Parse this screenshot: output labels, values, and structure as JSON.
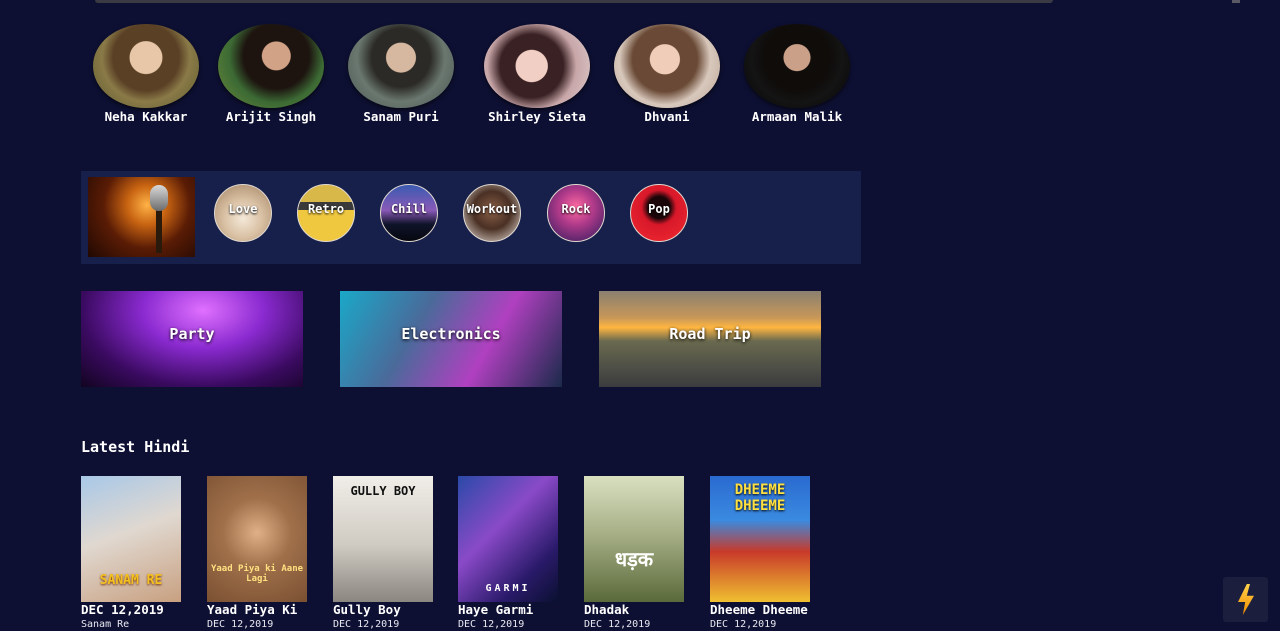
{
  "artists": [
    {
      "name": "Neha Kakkar",
      "color": "#7a6a3a"
    },
    {
      "name": "Arijit Singh",
      "color": "#4d6a3a"
    },
    {
      "name": "Sanam Puri",
      "color": "#5c6a62"
    },
    {
      "name": "Shirley Sieta",
      "color": "#b89a98"
    },
    {
      "name": "Dhvani",
      "color": "#c9b7a8"
    },
    {
      "name": "Armaan Malik",
      "color": "#181818"
    }
  ],
  "genres": [
    "Love",
    "Retro",
    "Chill",
    "Workout",
    "Rock",
    "Pop"
  ],
  "moods": [
    "Party",
    "Electronics",
    "Road Trip"
  ],
  "latest": {
    "title": "Latest Hindi",
    "items": [
      {
        "title": "DEC 12,2019",
        "sub": "Sanam Re",
        "cover_text": "SANAM RE"
      },
      {
        "title": "Yaad Piya Ki",
        "sub": "DEC 12,2019",
        "cover_text": "Yaad Piya ki Aane Lagi"
      },
      {
        "title": "Gully Boy",
        "sub": "DEC 12,2019",
        "cover_text": "GULLY BOY"
      },
      {
        "title": "Haye Garmi",
        "sub": "DEC 12,2019",
        "cover_text": "GARMI"
      },
      {
        "title": "Dhadak",
        "sub": "DEC 12,2019",
        "cover_text": "धड़क"
      },
      {
        "title": "Dheeme Dheeme",
        "sub": "DEC 12,2019",
        "cover_text": "DHEEME DHEEME"
      }
    ]
  }
}
